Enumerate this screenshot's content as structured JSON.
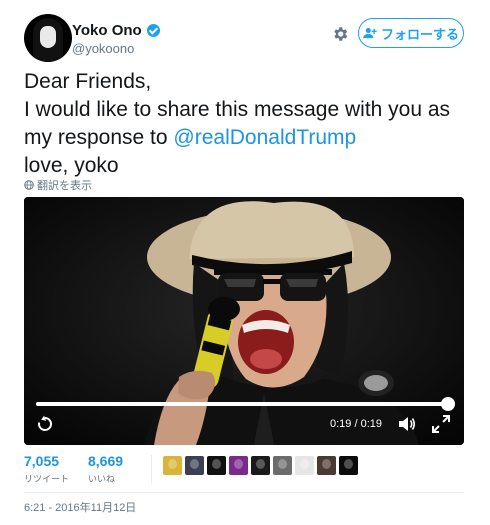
{
  "header": {
    "display_name": "Yoko Ono",
    "handle": "@yokoono",
    "follow_label": "フォローする"
  },
  "tweet": {
    "line1": "Dear Friends,",
    "line2": "I would like to share this message with you as",
    "line3_prefix": "my response to ",
    "mention": "@realDonaldTrump",
    "line4": "love, yoko",
    "translate_label": "翻訳を表示"
  },
  "video": {
    "time": "0:19 / 0:19",
    "progress": 1.0
  },
  "stats": {
    "retweets_count": "7,055",
    "retweets_label": "リツイート",
    "likes_count": "8,669",
    "likes_label": "いいね"
  },
  "likers": [
    {
      "name": "liker-1",
      "color": "#d9b43a"
    },
    {
      "name": "liker-2",
      "color": "#3b3f52"
    },
    {
      "name": "liker-3",
      "color": "#111111"
    },
    {
      "name": "liker-4",
      "color": "#7a2a8c"
    },
    {
      "name": "liker-5",
      "color": "#1a1a1a"
    },
    {
      "name": "liker-6",
      "color": "#6b6b6b"
    },
    {
      "name": "liker-7",
      "color": "#e6e6e6"
    },
    {
      "name": "liker-8",
      "color": "#4a3a33"
    },
    {
      "name": "liker-9",
      "color": "#0b0b0b"
    }
  ],
  "timestamp": "6:21 - 2016年11月12日",
  "colors": {
    "accent": "#1da1f2",
    "link": "#1b95e0",
    "muted": "#657786"
  },
  "icons": [
    "verified-icon",
    "gear-icon",
    "follow-person-icon",
    "globe-icon",
    "replay-icon",
    "volume-icon",
    "fullscreen-icon"
  ]
}
